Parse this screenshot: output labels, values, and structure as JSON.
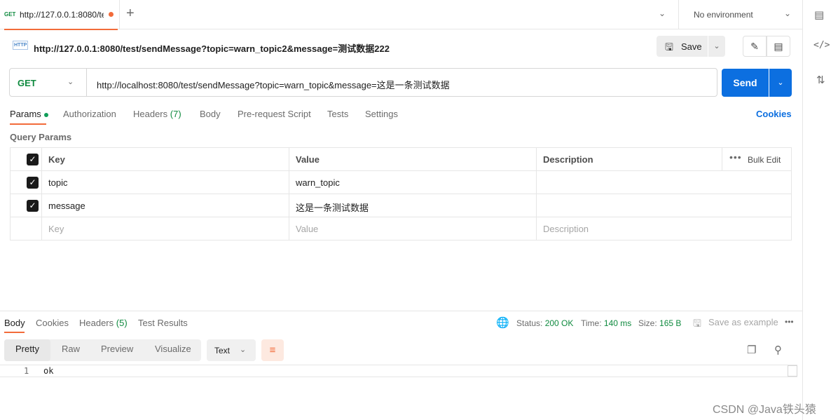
{
  "tab": {
    "method": "GET",
    "title": "http://127.0.0.1:8080/tes",
    "env": "No environment"
  },
  "request": {
    "icon_label": "HTTP",
    "name": "http://127.0.0.1:8080/test/sendMessage?topic=warn_topic2&message=测试数据222",
    "save_label": "Save",
    "method": "GET",
    "url": "http://localhost:8080/test/sendMessage?topic=warn_topic&message=这是一条测试数据",
    "send_label": "Send"
  },
  "request_tabs": {
    "params": "Params",
    "authorization": "Authorization",
    "headers": "Headers",
    "headers_count": "(7)",
    "body": "Body",
    "prerequest": "Pre-request Script",
    "tests": "Tests",
    "settings": "Settings",
    "cookies": "Cookies"
  },
  "query_params": {
    "title": "Query Params",
    "headers": {
      "key": "Key",
      "value": "Value",
      "description": "Description",
      "bulk_edit": "Bulk Edit"
    },
    "rows": [
      {
        "key": "topic",
        "value": "warn_topic",
        "description": ""
      },
      {
        "key": "message",
        "value": "这是一条测试数据",
        "description": ""
      }
    ],
    "placeholder": {
      "key": "Key",
      "value": "Value",
      "description": "Description"
    }
  },
  "response": {
    "tabs": {
      "body": "Body",
      "cookies": "Cookies",
      "headers": "Headers",
      "headers_count": "(5)",
      "test_results": "Test Results"
    },
    "status_label": "Status:",
    "status_value": "200 OK",
    "time_label": "Time:",
    "time_value": "140 ms",
    "size_label": "Size:",
    "size_value": "165 B",
    "save_example": "Save as example",
    "views": {
      "pretty": "Pretty",
      "raw": "Raw",
      "preview": "Preview",
      "visualize": "Visualize"
    },
    "format": "Text",
    "body_lines": [
      {
        "no": "1",
        "text": "ok"
      }
    ]
  },
  "watermark": "CSDN @Java铁头猿"
}
